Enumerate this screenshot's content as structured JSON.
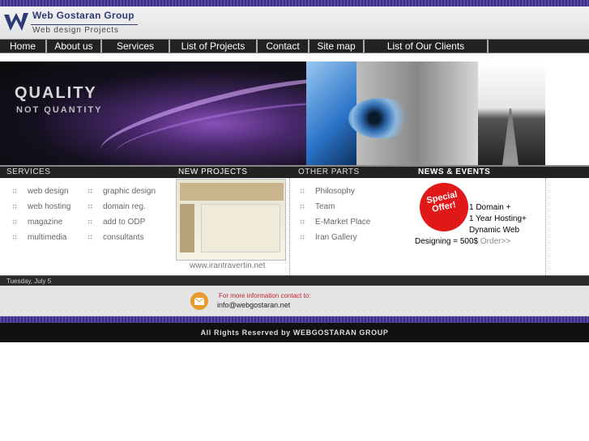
{
  "header": {
    "brand": "Web Gostaran Group",
    "subtitle": "Web design Projects"
  },
  "nav": [
    {
      "label": "Home"
    },
    {
      "label": "About us"
    },
    {
      "label": "Services"
    },
    {
      "label": "List of Projects"
    },
    {
      "label": "Contact"
    },
    {
      "label": "Site map"
    },
    {
      "label": "List of Our Clients"
    }
  ],
  "banner": {
    "line1": "QUALITY",
    "line2": "NOT QUANTITY"
  },
  "sections": {
    "services": "SERVICES",
    "new_projects": "NEW PROJECTS",
    "other_parts": "OTHER PARTS",
    "news": "NEWS & EVENTS"
  },
  "services": [
    "web design",
    "graphic design",
    "web hosting",
    "domain reg.",
    "magazine",
    "add to ODP",
    "multimedia",
    "consultants"
  ],
  "new_project_caption": "www.irantravertin.net",
  "other_parts": [
    "Philosophy",
    "Team",
    "E-Market Place",
    "Iran Gallery"
  ],
  "news": {
    "badge": "Special Offer!",
    "lines": [
      "1 Domain +",
      "1 Year Hosting+",
      "Dynamic Web"
    ],
    "last": "Designing = 500$",
    "order": "Order>>"
  },
  "date": "Tuesday, July 5",
  "contact": {
    "line1": "For more information contact to:",
    "email": "info@webgostaran.net"
  },
  "footer": "All Rights Reserved by WEBGOSTARAN GROUP",
  "colors": {
    "accent": "#5a4aa8",
    "nav": "#222222",
    "offer": "#e01818"
  }
}
